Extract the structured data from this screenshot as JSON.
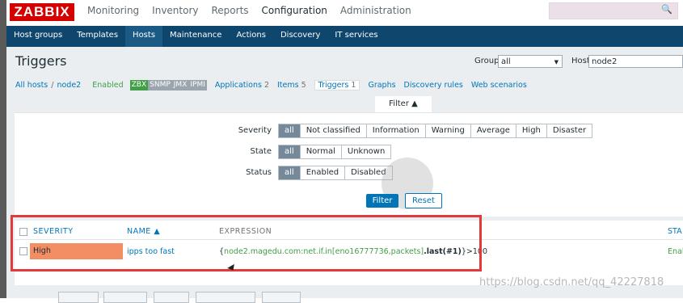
{
  "top": {
    "logo": "ZABBIX",
    "menu": [
      "Monitoring",
      "Inventory",
      "Reports",
      "Configuration",
      "Administration"
    ],
    "active_menu": "Configuration",
    "search_icon": "search-icon"
  },
  "subnav": {
    "items": [
      "Host groups",
      "Templates",
      "Hosts",
      "Maintenance",
      "Actions",
      "Discovery",
      "IT services"
    ],
    "active": "Hosts"
  },
  "page": {
    "title": "Triggers",
    "group_label": "Group",
    "group_value": "all",
    "host_label": "Host",
    "host_value": "node2"
  },
  "hostnav": {
    "all_hosts": "All hosts",
    "sep": "/",
    "host": "node2",
    "status": "Enabled",
    "badges": [
      "ZBX",
      "SNMP",
      "JMX",
      "IPMI"
    ],
    "items": [
      {
        "label": "Applications",
        "count": "2"
      },
      {
        "label": "Items",
        "count": "5"
      },
      {
        "label": "Triggers",
        "count": "1"
      },
      {
        "label": "Graphs",
        "count": ""
      },
      {
        "label": "Discovery rules",
        "count": ""
      },
      {
        "label": "Web scenarios",
        "count": ""
      }
    ]
  },
  "filter": {
    "tab_label": "Filter ▲",
    "severity_label": "Severity",
    "severity_options": [
      "all",
      "Not classified",
      "Information",
      "Warning",
      "Average",
      "High",
      "Disaster"
    ],
    "state_label": "State",
    "state_options": [
      "all",
      "Normal",
      "Unknown"
    ],
    "status_label": "Status",
    "status_options": [
      "all",
      "Enabled",
      "Disabled"
    ],
    "selected": "all",
    "filter_button": "Filter",
    "reset_button": "Reset"
  },
  "table": {
    "headers": {
      "severity": "SEVERITY",
      "name": "NAME ▲",
      "expression": "EXPRESSION",
      "status": "STA"
    },
    "rows": [
      {
        "severity": "High",
        "severity_color": "#f28d64",
        "name": "ipps too fast",
        "expr_open": "{",
        "expr_item": "node2.magedu.com:net.if.in[eno16777736,packets]",
        "expr_func": ".last(#1)",
        "expr_close": "}>100",
        "status": "Enal"
      }
    ]
  },
  "watermark": "https://blog.csdn.net/qq_42227818",
  "colors": {
    "brand": "#d40000",
    "nav": "#0e466d",
    "link": "#0275b8",
    "high": "#f28d64",
    "highlight_box": "#e23a3a"
  }
}
